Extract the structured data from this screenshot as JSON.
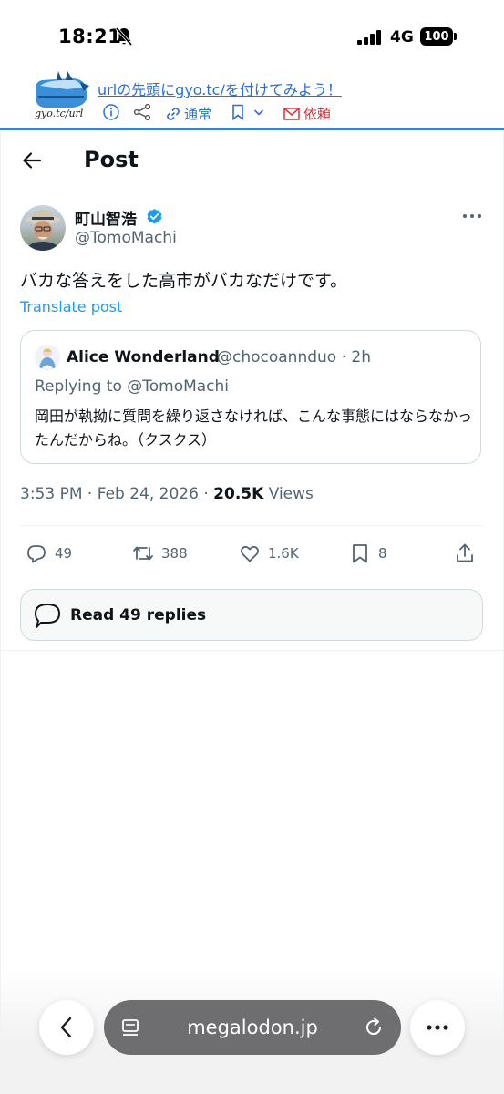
{
  "status_bar": {
    "time": "18:21",
    "network": "4G",
    "battery": "100"
  },
  "gyo_header": {
    "logo_text": "gyo.tc/url",
    "tagline": "urlの先頭にgyo.tc/を付けてみよう！",
    "normal_label": "通常",
    "request_label": "依頼"
  },
  "post_header": {
    "title": "Post"
  },
  "post": {
    "author_name": "町山智浩",
    "author_handle": "@TomoMachi",
    "text": "バカな答えをした高市がバカなだけです。",
    "translate": "Translate post",
    "time": "3:53 PM",
    "date": "Feb 24, 2026",
    "views_count": "20.5K",
    "views_label": "Views"
  },
  "quote": {
    "name": "Alice Wonderland",
    "handle_time": "@chocoannduo · 2h",
    "replying": "Replying to @TomoMachi",
    "text": "岡田が執拗に質問を繰り返さなければ、こんな事態にはならなかったんだからね。（クスクス）"
  },
  "actions": {
    "replies": "49",
    "reposts": "388",
    "likes": "1.6K",
    "bookmarks": "8"
  },
  "read_replies": "Read 49 replies",
  "browser": {
    "url": "megalodon.jp"
  },
  "colors": {
    "accent": "#1d9bf0",
    "gyo_link": "#2a6fd6",
    "gyo_request": "#d0363c"
  }
}
